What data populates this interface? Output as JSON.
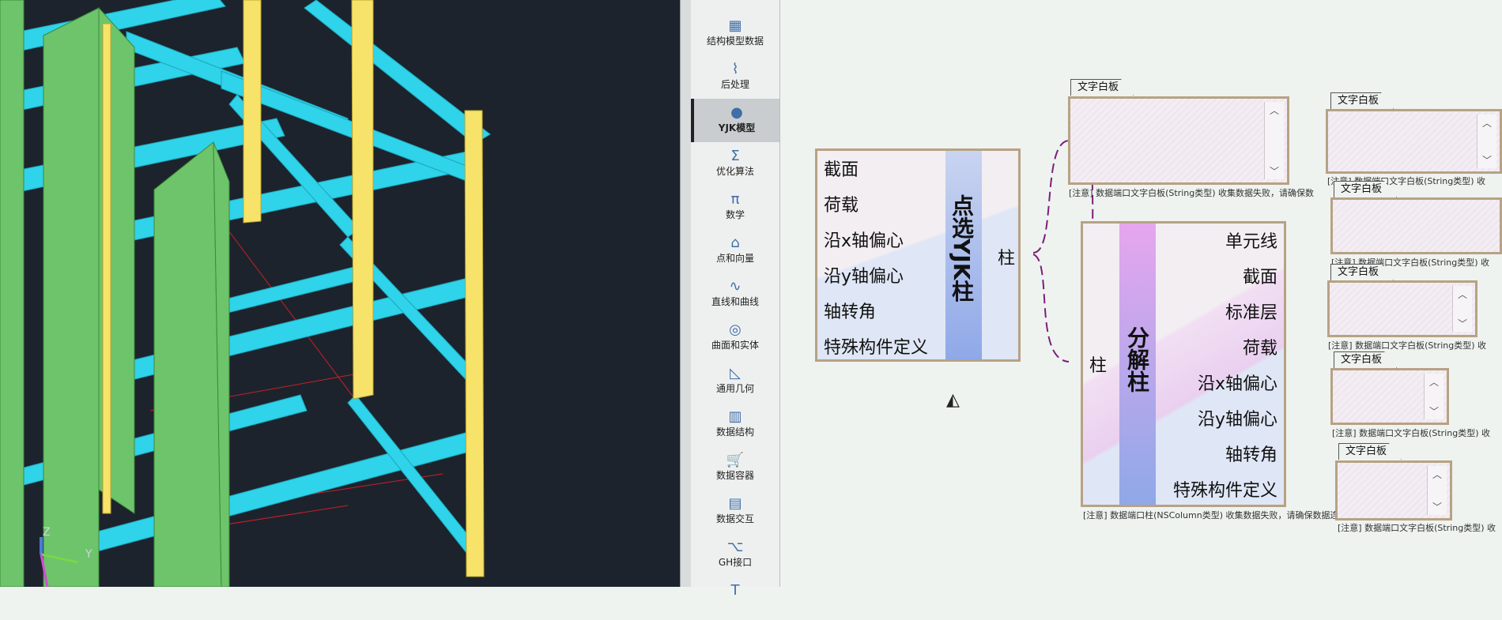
{
  "viewport": {
    "axis_z": "Z",
    "axis_y": "Y"
  },
  "toolbar": {
    "items": [
      {
        "label": "结构模型数据",
        "icon": "grid-icon",
        "glyph": "▦"
      },
      {
        "label": "后处理",
        "icon": "chart-icon",
        "glyph": "⌇"
      },
      {
        "label": "YJK模型",
        "icon": "yjk-logo-icon",
        "glyph": "●"
      },
      {
        "label": "优化算法",
        "icon": "sigma-icon",
        "glyph": "Σ"
      },
      {
        "label": "数学",
        "icon": "pi-icon",
        "glyph": "π"
      },
      {
        "label": "点和向量",
        "icon": "point-vector-icon",
        "glyph": "⌂"
      },
      {
        "label": "直线和曲线",
        "icon": "curve-icon",
        "glyph": "∿"
      },
      {
        "label": "曲面和实体",
        "icon": "surface-icon",
        "glyph": "◎"
      },
      {
        "label": "通用几何",
        "icon": "triangle-ruler-icon",
        "glyph": "◺"
      },
      {
        "label": "数据结构",
        "icon": "bar-chart-icon",
        "glyph": "▥"
      },
      {
        "label": "数据容器",
        "icon": "cart-icon",
        "glyph": "🛒"
      },
      {
        "label": "数据交互",
        "icon": "screen-icon",
        "glyph": "▤"
      },
      {
        "label": "GH接口",
        "icon": "gh-icon",
        "glyph": "⌥"
      },
      {
        "label": "",
        "icon": "text-tool-icon",
        "glyph": "T"
      }
    ],
    "active": "YJK模型"
  },
  "nodes": {
    "pick_column": {
      "title": "点选YJK柱",
      "inputs": [
        "截面",
        "荷载",
        "沿x轴偏心",
        "沿y轴偏心",
        "轴转角",
        "特殊构件定义"
      ],
      "output": "柱"
    },
    "decompose_column": {
      "title": "分解柱",
      "input": "柱",
      "outputs": [
        "单元线",
        "截面",
        "标准层",
        "荷载",
        "沿x轴偏心",
        "沿y轴偏心",
        "轴转角",
        "特殊构件定义"
      ],
      "note": "[注意] 数据端口柱(NSColumn类型) 收集数据失败，请确保数据连接。"
    }
  },
  "panels": {
    "title": "文字白板",
    "scroll_up": "︿",
    "scroll_down": "﹀",
    "notes": [
      "[注意] 数据端口文字白板(String类型) 收集数据失败，请确保数",
      "[注意] 数据端口文字白板(String类型) 收",
      "[注意] 数据端口文字白板(String类型) 收",
      "[注意] 数据端口文字白板(String类型) 收",
      "[注意] 数据端口文字白板(String类型) 收",
      "[注意] 数据端口文字白板(String类型) 收"
    ]
  },
  "colors": {
    "beam": "#2fd3ea",
    "column": "#f8e36a",
    "wall": "#6dc46a",
    "wire": "#7d1e7c",
    "node_border": "#b7a284",
    "band_blue": "#8fa8e8",
    "band_pink": "#e6a6ee"
  }
}
